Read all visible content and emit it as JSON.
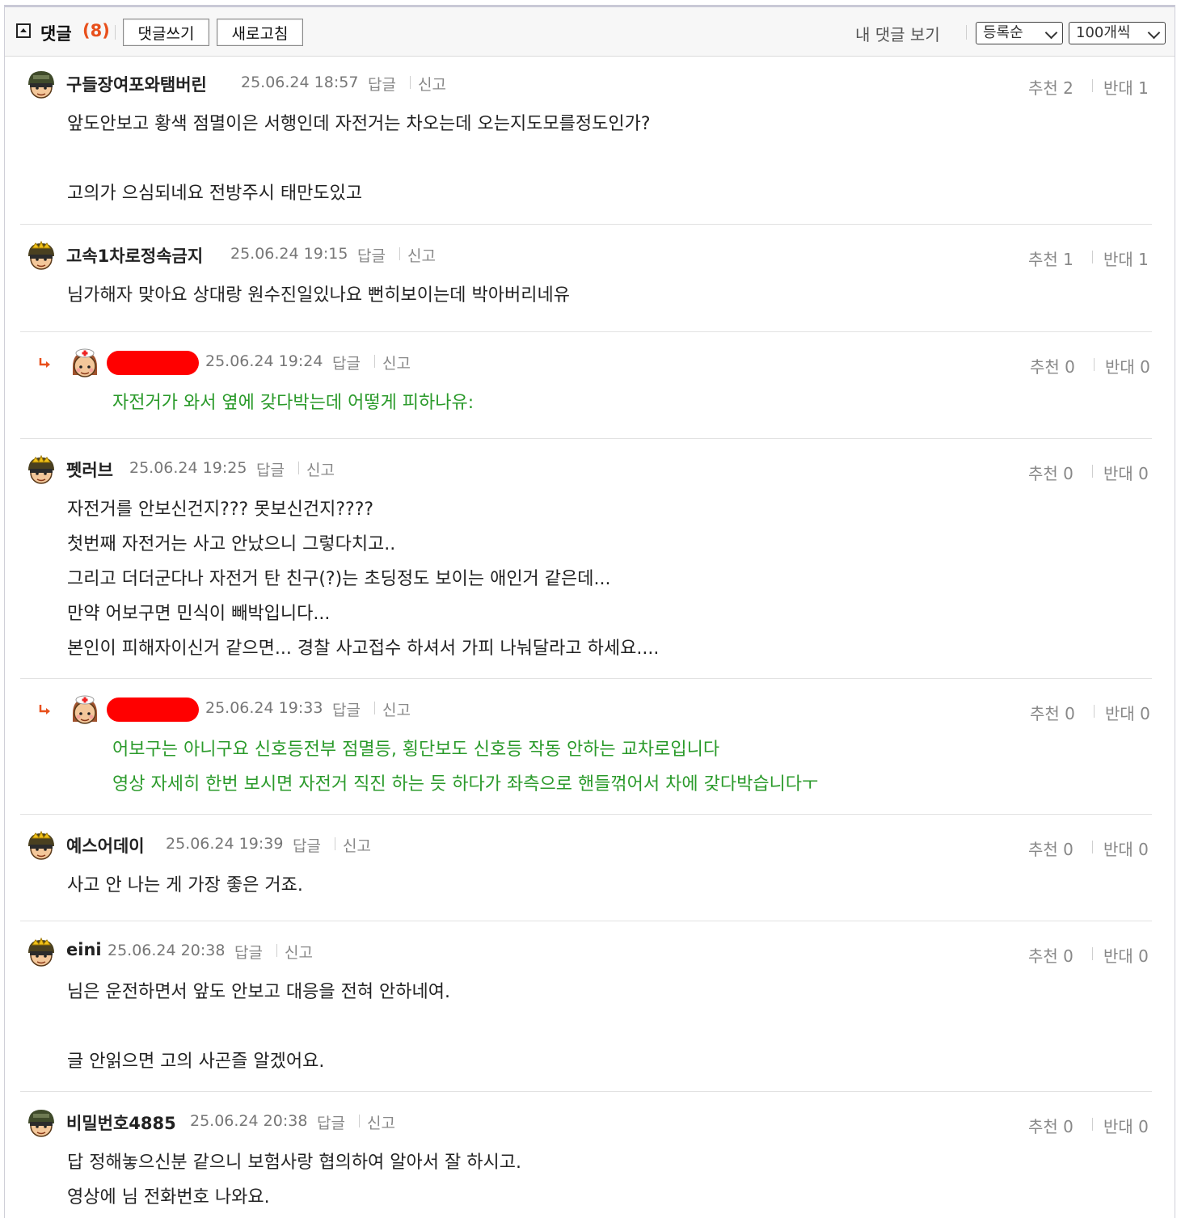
{
  "header": {
    "title": "댓글",
    "count": "(8)",
    "write_button": "댓글쓰기",
    "refresh_button": "새로고침",
    "my_comments_link": "내 댓글 보기",
    "sort_select": "등록순",
    "per_page_select": "100개씩"
  },
  "labels": {
    "reply": "답글",
    "report": "신고",
    "recommend": "추천",
    "oppose": "반대"
  },
  "comments": [
    {
      "nick": "구들장여포와탬버린",
      "date": "25.06.24 18:57",
      "up": "2",
      "down": "1",
      "lines": [
        "앞도안보고 황색 점멸이은 서행인데 자전거는 차오는데 오는지도모를정도인가?",
        "",
        "고의가 으심되네요 전방주시 태만도있고"
      ]
    },
    {
      "nick": "고속1차로정속금지",
      "date": "25.06.24 19:15",
      "up": "1",
      "down": "1",
      "lines": [
        "님가해자 맞아요 상대랑 원수진일있나요 뻔히보이는데 박아버리네유"
      ]
    },
    {
      "nick": "",
      "date": "25.06.24 19:24",
      "up": "0",
      "down": "0",
      "lines": [
        "자전거가 와서 옆에 갖다박는데 어떻게 피하나유:"
      ]
    },
    {
      "nick": "펫러브",
      "date": "25.06.24 19:25",
      "up": "0",
      "down": "0",
      "lines": [
        "자전거를 안보신건지??? 못보신건지????",
        "첫번째 자전거는 사고 안났으니 그렇다치고..",
        "그리고 더더군다나 자전거 탄 친구(?)는 초딩정도 보이는 애인거 같은데...",
        "만약 어보구면 민식이 빼박입니다...",
        "본인이 피해자이신거 같으면... 경찰 사고접수 하셔서 가피 나눠달라고 하세요...."
      ]
    },
    {
      "nick": "",
      "date": "25.06.24 19:33",
      "up": "0",
      "down": "0",
      "lines": [
        "어보구는 아니구요 신호등전부 점멸등, 횡단보도 신호등 작동 안하는 교차로입니다",
        "영상 자세히 한번 보시면 자전거 직진 하는 듯 하다가 좌측으로 핸들꺾어서 차에 갖다박습니다ㅜ"
      ]
    },
    {
      "nick": "예스어데이",
      "date": "25.06.24 19:39",
      "up": "0",
      "down": "0",
      "lines": [
        "사고 안 나는 게 가장 좋은 거죠."
      ]
    },
    {
      "nick": "eini",
      "date": "25.06.24 20:38",
      "up": "0",
      "down": "0",
      "lines": [
        "님은 운전하면서 앞도 안보고 대응을 전혀 안하네여.",
        "",
        "글 안읽으면 고의 사곤즐 알겠어요."
      ]
    },
    {
      "nick": "비밀번호4885",
      "date": "25.06.24 20:38",
      "up": "0",
      "down": "0",
      "lines": [
        "답 정해놓으신분 같으니 보험사랑 협의하여 알아서 잘 하시고.",
        "영상에 님 전화번호 나와요."
      ]
    }
  ],
  "colors": {
    "count": "#e8501c",
    "reply_text": "#2a9a2a",
    "redaction": "#ff0000"
  }
}
